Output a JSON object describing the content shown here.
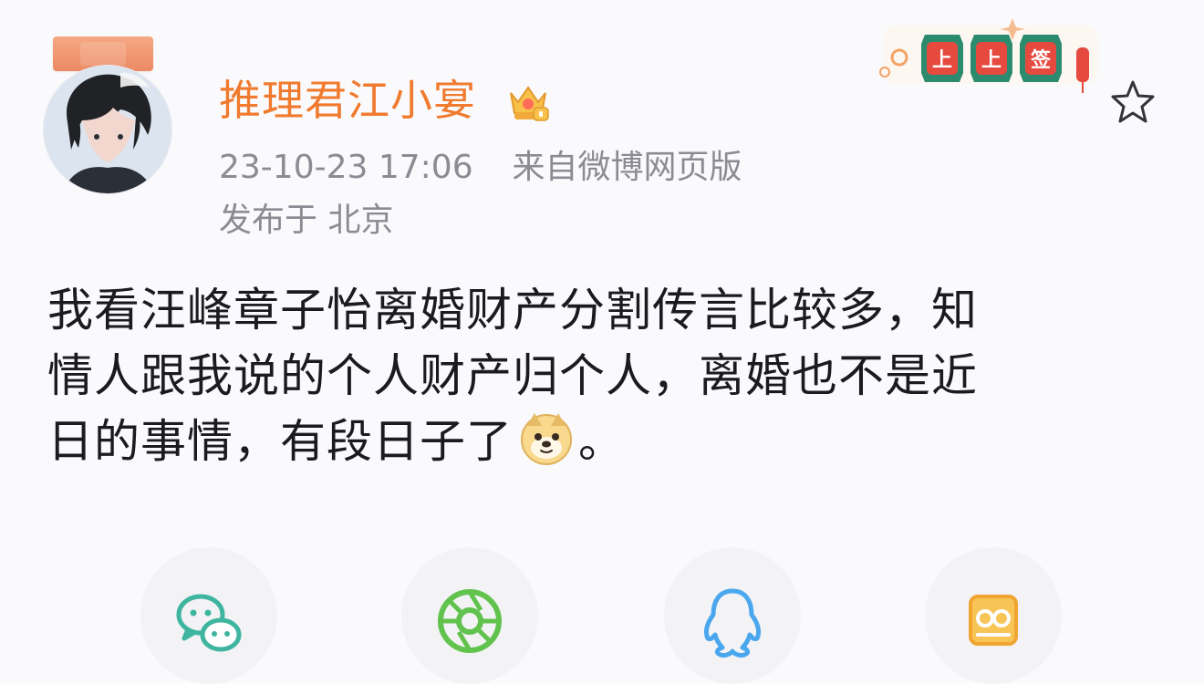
{
  "post": {
    "author_name": "推理君江小宴",
    "timestamp": "23-10-23 17:06",
    "source": "来自微博网页版",
    "location": "发布于 北京",
    "text_lines": [
      "我看汪峰章子怡离婚财产分割传言比较多，知",
      "情人跟我说的个人财产归个人，离婚也不是近",
      "日的事情，有段日子了"
    ],
    "text_end": "。"
  },
  "badge": {
    "sign_text": [
      "上",
      "上",
      "签"
    ]
  },
  "share": {
    "items": [
      "wechat-icon",
      "moments-icon",
      "qq-icon",
      "qzone-icon"
    ]
  },
  "colors": {
    "name": "#f07a2e",
    "meta": "#8b8b93",
    "text": "#1b1b1f",
    "share_green": "#3fb5a0",
    "share_lime": "#61c34d",
    "share_blue": "#4aa7ee",
    "share_orange": "#f0b440"
  }
}
